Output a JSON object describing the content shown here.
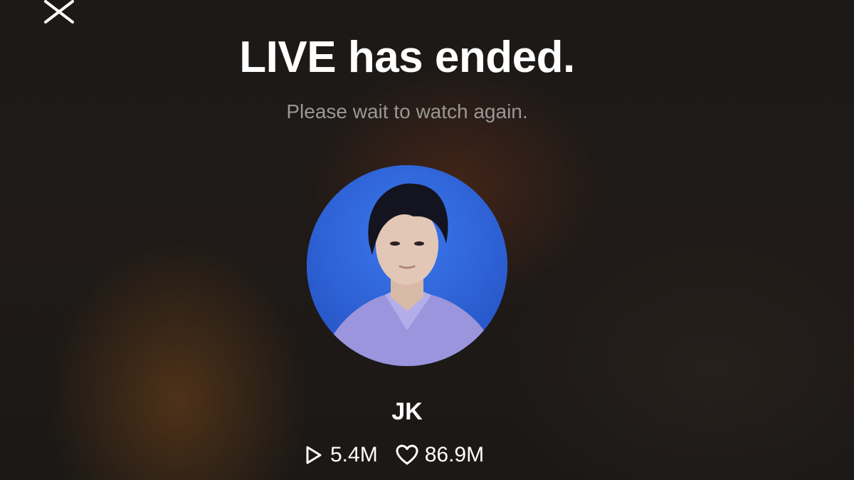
{
  "live_ended": {
    "title": "LIVE has ended.",
    "subtitle": "Please wait to watch again."
  },
  "profile": {
    "username": "JK",
    "avatar_background": "#2f63d8"
  },
  "stats": {
    "plays": "5.4M",
    "plays_icon": "play-icon",
    "likes": "86.9M",
    "likes_icon": "heart-icon"
  },
  "controls": {
    "close_icon": "close-icon"
  }
}
